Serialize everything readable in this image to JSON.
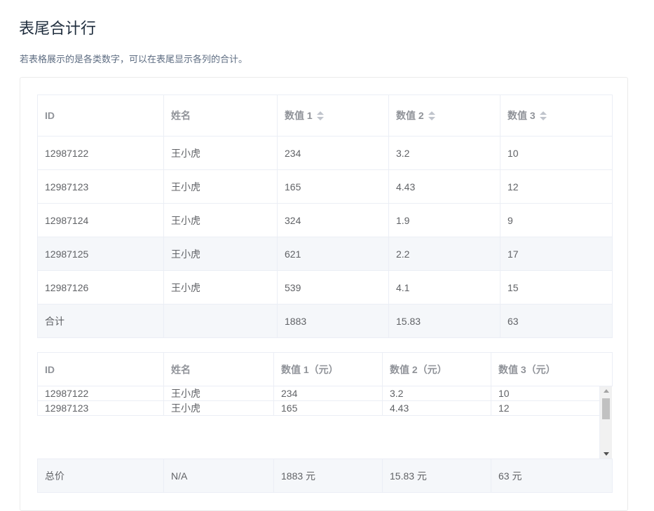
{
  "page": {
    "title": "表尾合计行",
    "description": "若表格展示的是各类数字，可以在表尾显示各列的合计。"
  },
  "table1": {
    "headers": [
      "ID",
      "姓名",
      "数值 1",
      "数值 2",
      "数值 3"
    ],
    "rows": [
      [
        "12987122",
        "王小虎",
        "234",
        "3.2",
        "10"
      ],
      [
        "12987123",
        "王小虎",
        "165",
        "4.43",
        "12"
      ],
      [
        "12987124",
        "王小虎",
        "324",
        "1.9",
        "9"
      ],
      [
        "12987125",
        "王小虎",
        "621",
        "2.2",
        "17"
      ],
      [
        "12987126",
        "王小虎",
        "539",
        "4.1",
        "15"
      ]
    ],
    "footer": [
      "合计",
      "",
      "1883",
      "15.83",
      "63"
    ]
  },
  "table2": {
    "headers": [
      "ID",
      "姓名",
      "数值 1（元）",
      "数值 2（元）",
      "数值 3（元）"
    ],
    "rows": [
      [
        "12987122",
        "王小虎",
        "234",
        "3.2",
        "10"
      ],
      [
        "12987123",
        "王小虎",
        "165",
        "4.43",
        "12"
      ]
    ],
    "footer": [
      "总价",
      "N/A",
      "1883 元",
      "15.83 元",
      "63 元"
    ]
  },
  "colors": {
    "border": "#ebeef5",
    "header_text": "#909399",
    "cell_text": "#606266",
    "footer_bg": "#f5f7fa",
    "hover_bg": "#f5f7fa"
  }
}
